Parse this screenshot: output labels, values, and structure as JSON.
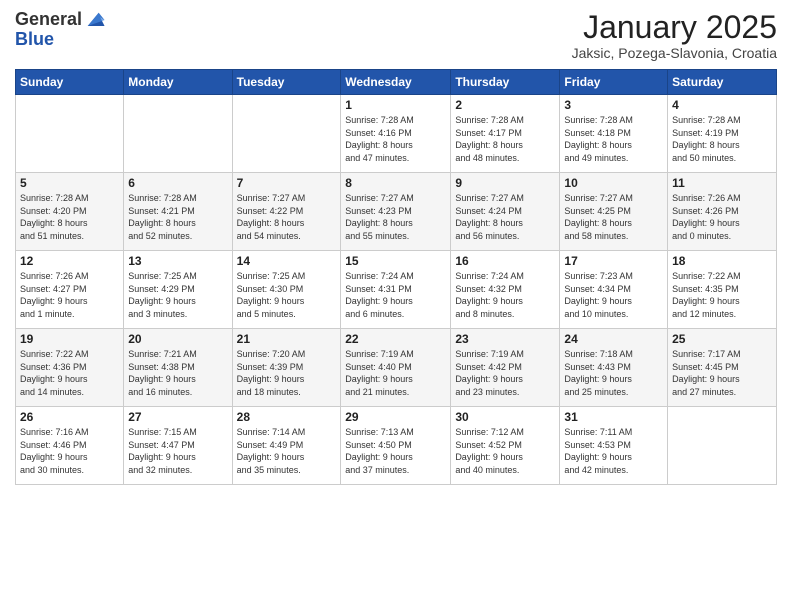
{
  "logo": {
    "general": "General",
    "blue": "Blue"
  },
  "header": {
    "title": "January 2025",
    "location": "Jaksic, Pozega-Slavonia, Croatia"
  },
  "weekdays": [
    "Sunday",
    "Monday",
    "Tuesday",
    "Wednesday",
    "Thursday",
    "Friday",
    "Saturday"
  ],
  "weeks": [
    [
      {
        "day": "",
        "info": ""
      },
      {
        "day": "",
        "info": ""
      },
      {
        "day": "",
        "info": ""
      },
      {
        "day": "1",
        "info": "Sunrise: 7:28 AM\nSunset: 4:16 PM\nDaylight: 8 hours\nand 47 minutes."
      },
      {
        "day": "2",
        "info": "Sunrise: 7:28 AM\nSunset: 4:17 PM\nDaylight: 8 hours\nand 48 minutes."
      },
      {
        "day": "3",
        "info": "Sunrise: 7:28 AM\nSunset: 4:18 PM\nDaylight: 8 hours\nand 49 minutes."
      },
      {
        "day": "4",
        "info": "Sunrise: 7:28 AM\nSunset: 4:19 PM\nDaylight: 8 hours\nand 50 minutes."
      }
    ],
    [
      {
        "day": "5",
        "info": "Sunrise: 7:28 AM\nSunset: 4:20 PM\nDaylight: 8 hours\nand 51 minutes."
      },
      {
        "day": "6",
        "info": "Sunrise: 7:28 AM\nSunset: 4:21 PM\nDaylight: 8 hours\nand 52 minutes."
      },
      {
        "day": "7",
        "info": "Sunrise: 7:27 AM\nSunset: 4:22 PM\nDaylight: 8 hours\nand 54 minutes."
      },
      {
        "day": "8",
        "info": "Sunrise: 7:27 AM\nSunset: 4:23 PM\nDaylight: 8 hours\nand 55 minutes."
      },
      {
        "day": "9",
        "info": "Sunrise: 7:27 AM\nSunset: 4:24 PM\nDaylight: 8 hours\nand 56 minutes."
      },
      {
        "day": "10",
        "info": "Sunrise: 7:27 AM\nSunset: 4:25 PM\nDaylight: 8 hours\nand 58 minutes."
      },
      {
        "day": "11",
        "info": "Sunrise: 7:26 AM\nSunset: 4:26 PM\nDaylight: 9 hours\nand 0 minutes."
      }
    ],
    [
      {
        "day": "12",
        "info": "Sunrise: 7:26 AM\nSunset: 4:27 PM\nDaylight: 9 hours\nand 1 minute."
      },
      {
        "day": "13",
        "info": "Sunrise: 7:25 AM\nSunset: 4:29 PM\nDaylight: 9 hours\nand 3 minutes."
      },
      {
        "day": "14",
        "info": "Sunrise: 7:25 AM\nSunset: 4:30 PM\nDaylight: 9 hours\nand 5 minutes."
      },
      {
        "day": "15",
        "info": "Sunrise: 7:24 AM\nSunset: 4:31 PM\nDaylight: 9 hours\nand 6 minutes."
      },
      {
        "day": "16",
        "info": "Sunrise: 7:24 AM\nSunset: 4:32 PM\nDaylight: 9 hours\nand 8 minutes."
      },
      {
        "day": "17",
        "info": "Sunrise: 7:23 AM\nSunset: 4:34 PM\nDaylight: 9 hours\nand 10 minutes."
      },
      {
        "day": "18",
        "info": "Sunrise: 7:22 AM\nSunset: 4:35 PM\nDaylight: 9 hours\nand 12 minutes."
      }
    ],
    [
      {
        "day": "19",
        "info": "Sunrise: 7:22 AM\nSunset: 4:36 PM\nDaylight: 9 hours\nand 14 minutes."
      },
      {
        "day": "20",
        "info": "Sunrise: 7:21 AM\nSunset: 4:38 PM\nDaylight: 9 hours\nand 16 minutes."
      },
      {
        "day": "21",
        "info": "Sunrise: 7:20 AM\nSunset: 4:39 PM\nDaylight: 9 hours\nand 18 minutes."
      },
      {
        "day": "22",
        "info": "Sunrise: 7:19 AM\nSunset: 4:40 PM\nDaylight: 9 hours\nand 21 minutes."
      },
      {
        "day": "23",
        "info": "Sunrise: 7:19 AM\nSunset: 4:42 PM\nDaylight: 9 hours\nand 23 minutes."
      },
      {
        "day": "24",
        "info": "Sunrise: 7:18 AM\nSunset: 4:43 PM\nDaylight: 9 hours\nand 25 minutes."
      },
      {
        "day": "25",
        "info": "Sunrise: 7:17 AM\nSunset: 4:45 PM\nDaylight: 9 hours\nand 27 minutes."
      }
    ],
    [
      {
        "day": "26",
        "info": "Sunrise: 7:16 AM\nSunset: 4:46 PM\nDaylight: 9 hours\nand 30 minutes."
      },
      {
        "day": "27",
        "info": "Sunrise: 7:15 AM\nSunset: 4:47 PM\nDaylight: 9 hours\nand 32 minutes."
      },
      {
        "day": "28",
        "info": "Sunrise: 7:14 AM\nSunset: 4:49 PM\nDaylight: 9 hours\nand 35 minutes."
      },
      {
        "day": "29",
        "info": "Sunrise: 7:13 AM\nSunset: 4:50 PM\nDaylight: 9 hours\nand 37 minutes."
      },
      {
        "day": "30",
        "info": "Sunrise: 7:12 AM\nSunset: 4:52 PM\nDaylight: 9 hours\nand 40 minutes."
      },
      {
        "day": "31",
        "info": "Sunrise: 7:11 AM\nSunset: 4:53 PM\nDaylight: 9 hours\nand 42 minutes."
      },
      {
        "day": "",
        "info": ""
      }
    ]
  ]
}
